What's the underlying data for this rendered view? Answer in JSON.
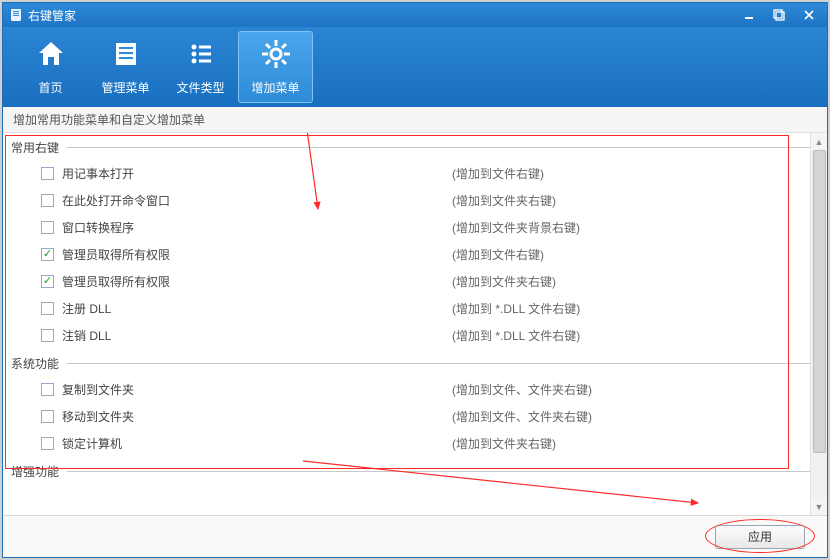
{
  "window": {
    "title": "右键管家"
  },
  "toolbar": {
    "items": [
      {
        "label": "首页",
        "icon": "home-icon",
        "active": false
      },
      {
        "label": "管理菜单",
        "icon": "list-icon",
        "active": false
      },
      {
        "label": "文件类型",
        "icon": "options-icon",
        "active": false
      },
      {
        "label": "增加菜单",
        "icon": "gear-icon",
        "active": true
      }
    ]
  },
  "subheader": "增加常用功能菜单和自定义增加菜单",
  "groups": [
    {
      "title": "常用右键",
      "rows": [
        {
          "label": "用记事本打开",
          "hint": "(增加到文件右键)",
          "checked": false
        },
        {
          "label": "在此处打开命令窗口",
          "hint": "(增加到文件夹右键)",
          "checked": false
        },
        {
          "label": "窗口转换程序",
          "hint": "(增加到文件夹背景右键)",
          "checked": false
        },
        {
          "label": "管理员取得所有权限",
          "hint": "(增加到文件右键)",
          "checked": true
        },
        {
          "label": "管理员取得所有权限",
          "hint": "(增加到文件夹右键)",
          "checked": true
        },
        {
          "label": "注册 DLL",
          "hint": "(增加到 *.DLL 文件右键)",
          "checked": false
        },
        {
          "label": "注销 DLL",
          "hint": "(增加到 *.DLL 文件右键)",
          "checked": false
        }
      ]
    },
    {
      "title": "系统功能",
      "rows": [
        {
          "label": "复制到文件夹",
          "hint": "(增加到文件、文件夹右键)",
          "checked": false
        },
        {
          "label": "移动到文件夹",
          "hint": "(增加到文件、文件夹右键)",
          "checked": false
        },
        {
          "label": "锁定计算机",
          "hint": "(增加到文件夹右键)",
          "checked": false
        }
      ]
    },
    {
      "title": "增强功能",
      "rows": []
    }
  ],
  "footer": {
    "apply_label": "应用"
  }
}
